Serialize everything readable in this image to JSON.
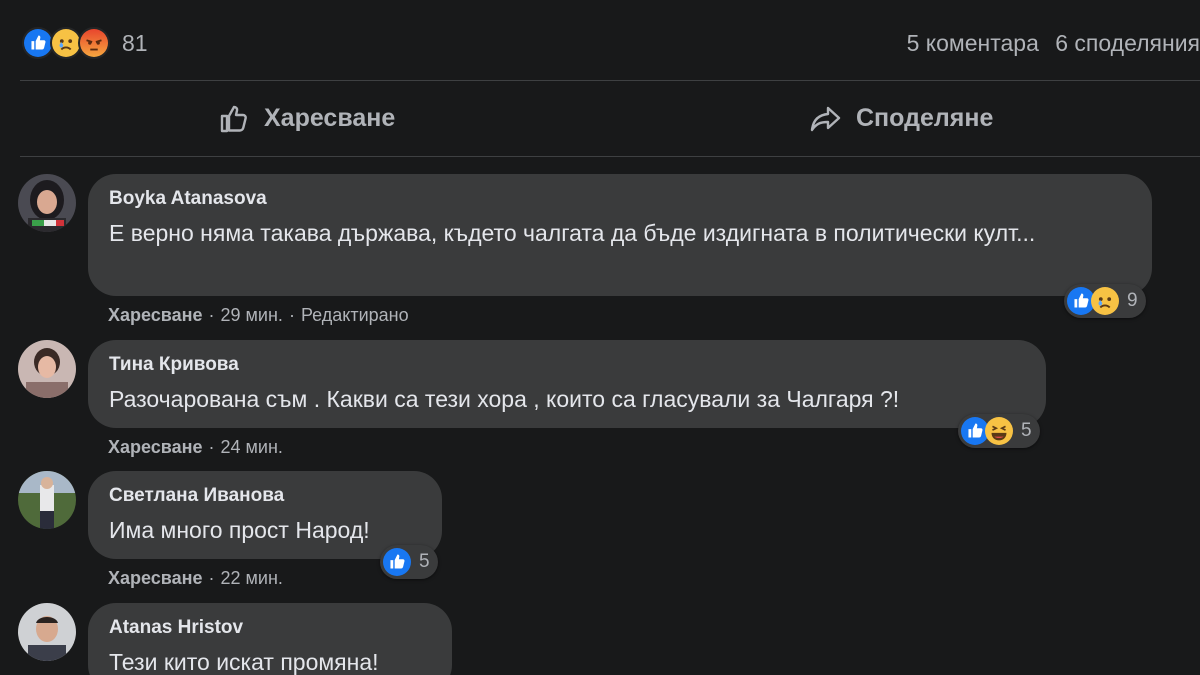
{
  "post": {
    "reaction_count": "81",
    "reactions": [
      "like-icon",
      "sad-icon",
      "angry-icon"
    ],
    "comments_count": "5 коментара",
    "shares_count": "6 споделяния"
  },
  "actions": {
    "like_label": "Харесване",
    "share_label": "Споделяне"
  },
  "colors": {
    "background": "#18191a",
    "bubble": "#3a3b3c",
    "like_blue": "#1877f2",
    "text": "#e4e6eb",
    "muted": "#b0b3b8"
  },
  "comments": [
    {
      "author": "Boyka Atanasova",
      "text": "Е верно няма такава държава, където чалгата да бъде издигната в политически култ...",
      "like_label": "Харесване",
      "time": "29 мин.",
      "edited": "Редактирано",
      "reaction_count": "9",
      "reactions": [
        "like-icon",
        "sad-icon"
      ]
    },
    {
      "author": "Тина Кривова",
      "text": "Разочарована съм . Какви са тези хора , които са гласували за Чалгаря ?!",
      "like_label": "Харесване",
      "time": "24 мин.",
      "reaction_count": "5",
      "reactions": [
        "like-icon",
        "haha-icon"
      ]
    },
    {
      "author": "Светлана Иванова",
      "text": "Има много прост Народ!",
      "like_label": "Харесване",
      "time": "22 мин.",
      "reaction_count": "5",
      "reactions": [
        "like-icon"
      ]
    },
    {
      "author": "Atanas Hristov",
      "text": "Тези кито искат промяна!"
    }
  ]
}
